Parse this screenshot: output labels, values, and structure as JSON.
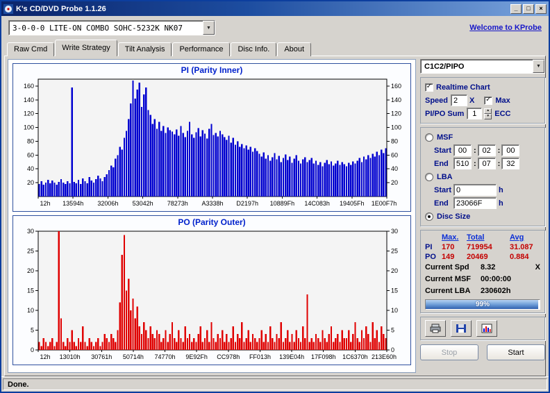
{
  "window": {
    "title": "K's CD/DVD Probe 1.1.26",
    "status": "Done."
  },
  "icons": {
    "minimize": "_",
    "maximize": "□",
    "close": "×",
    "combo_arrow": "▼",
    "check": "✓",
    "spinner_up": "▲",
    "spinner_down": "▼"
  },
  "toolbar": {
    "drive_selected": "3-0-0-0 LITE-ON COMBO SOHC-5232K NK07",
    "welcome_link": "Welcome to KProbe"
  },
  "tabs": {
    "items": [
      "Raw Cmd",
      "Write Strategy",
      "Tilt Analysis",
      "Performance",
      "Disc Info.",
      "About"
    ],
    "active": "Write Strategy"
  },
  "chart_data": [
    {
      "type": "bar",
      "title": "PI (Parity Inner)",
      "color": "#0000d0",
      "ylim": [
        0,
        170
      ],
      "yticks": [
        20,
        40,
        60,
        80,
        100,
        120,
        140,
        160
      ],
      "xtick_labels": [
        "12h",
        "13594h",
        "32006h",
        "53042h",
        "78273h",
        "A3338h",
        "D2197h",
        "10889Fh",
        "14C083h",
        "19405Fh",
        "1E00F7h"
      ],
      "values": [
        18,
        22,
        17,
        20,
        24,
        19,
        23,
        20,
        17,
        21,
        25,
        20,
        18,
        22,
        19,
        158,
        21,
        19,
        24,
        18,
        26,
        22,
        19,
        28,
        23,
        20,
        25,
        30,
        26,
        22,
        28,
        32,
        38,
        45,
        42,
        55,
        60,
        72,
        68,
        85,
        95,
        112,
        135,
        168,
        142,
        155,
        165,
        130,
        148,
        158,
        125,
        118,
        105,
        112,
        98,
        108,
        95,
        102,
        92,
        100,
        96,
        94,
        90,
        97,
        88,
        102,
        92,
        86,
        95,
        108,
        90,
        85,
        93,
        99,
        87,
        96,
        91,
        84,
        98,
        105,
        89,
        92,
        87,
        95,
        90,
        86,
        82,
        88,
        78,
        85,
        75,
        80,
        72,
        76,
        70,
        74,
        68,
        72,
        65,
        70,
        66,
        62,
        58,
        64,
        55,
        60,
        52,
        57,
        63,
        54,
        59,
        50,
        56,
        61,
        53,
        58,
        49,
        55,
        60,
        52,
        48,
        54,
        57,
        50,
        53,
        56,
        48,
        52,
        46,
        50,
        44,
        49,
        53,
        47,
        51,
        45,
        48,
        52,
        46,
        50,
        47,
        44,
        49,
        46,
        51,
        48,
        52,
        56,
        50,
        58,
        54,
        60,
        56,
        62,
        58,
        65,
        60,
        68,
        63,
        70
      ]
    },
    {
      "type": "bar",
      "title": "PO (Parity Outer)",
      "color": "#e00000",
      "ylim": [
        0,
        30
      ],
      "yticks": [
        0,
        5,
        10,
        15,
        20,
        25,
        30
      ],
      "xtick_labels": [
        "12h",
        "13010h",
        "30761h",
        "50714h",
        "74770h",
        "9E92Fh",
        "CC978h",
        "FF013h",
        "139E04h",
        "17F098h",
        "1C6370h",
        "213E60h"
      ],
      "values": [
        2,
        1,
        3,
        2,
        1,
        2,
        3,
        1,
        2,
        30,
        8,
        2,
        1,
        3,
        2,
        5,
        2,
        1,
        3,
        2,
        6,
        2,
        1,
        3,
        2,
        1,
        2,
        3,
        1,
        2,
        4,
        3,
        2,
        4,
        3,
        2,
        5,
        12,
        24,
        29,
        15,
        18,
        10,
        13,
        8,
        11,
        6,
        4,
        7,
        5,
        3,
        6,
        4,
        3,
        5,
        4,
        2,
        3,
        5,
        2,
        4,
        7,
        3,
        2,
        5,
        3,
        2,
        6,
        3,
        4,
        2,
        3,
        2,
        4,
        6,
        2,
        3,
        5,
        2,
        7,
        3,
        2,
        4,
        3,
        5,
        2,
        4,
        2,
        3,
        6,
        2,
        4,
        3,
        7,
        2,
        3,
        5,
        2,
        4,
        3,
        2,
        3,
        5,
        2,
        4,
        2,
        6,
        3,
        2,
        4,
        3,
        7,
        2,
        3,
        5,
        2,
        4,
        2,
        5,
        3,
        2,
        6,
        3,
        14,
        2,
        3,
        2,
        4,
        3,
        2,
        5,
        3,
        2,
        4,
        6,
        2,
        3,
        4,
        2,
        5,
        3,
        3,
        5,
        2,
        4,
        7,
        3,
        2,
        5,
        3,
        6,
        4,
        2,
        7,
        3,
        5,
        2,
        6,
        4,
        3
      ]
    }
  ],
  "sidebar": {
    "mode_select": "C1C2/PIPO",
    "realtime_label": "Realtime Chart",
    "speed": {
      "label": "Speed",
      "value": "2",
      "unit": "X",
      "max_label": "Max"
    },
    "pipo_sum": {
      "label": "PI/PO Sum",
      "value": "1",
      "unit": "ECC"
    },
    "msf": {
      "label": "MSF",
      "start_label": "Start",
      "end_label": "End",
      "separator": ":",
      "start": [
        "00",
        "02",
        "00"
      ],
      "end": [
        "510",
        "07",
        "32"
      ]
    },
    "lba": {
      "label": "LBA",
      "start_label": "Start",
      "end_label": "End",
      "start": "0",
      "end": "23066F",
      "unit": "h"
    },
    "disc_size_label": "Disc Size",
    "stats": {
      "headers": [
        "Max.",
        "Total",
        "Avg"
      ],
      "rows": [
        {
          "label": "PI",
          "max": "170",
          "total": "719954",
          "avg": "31.087"
        },
        {
          "label": "PO",
          "max": "149",
          "total": "20469",
          "avg": "0.884"
        }
      ]
    },
    "current": [
      {
        "label": "Current Spd",
        "value": "8.32",
        "unit": "X"
      },
      {
        "label": "Current MSF",
        "value": "00:00:00",
        "unit": ""
      },
      {
        "label": "Current LBA",
        "value": "230602h",
        "unit": ""
      }
    ],
    "progress": {
      "percent": 99,
      "text": "99%"
    },
    "buttons": {
      "stop": "Stop",
      "start": "Start"
    }
  }
}
